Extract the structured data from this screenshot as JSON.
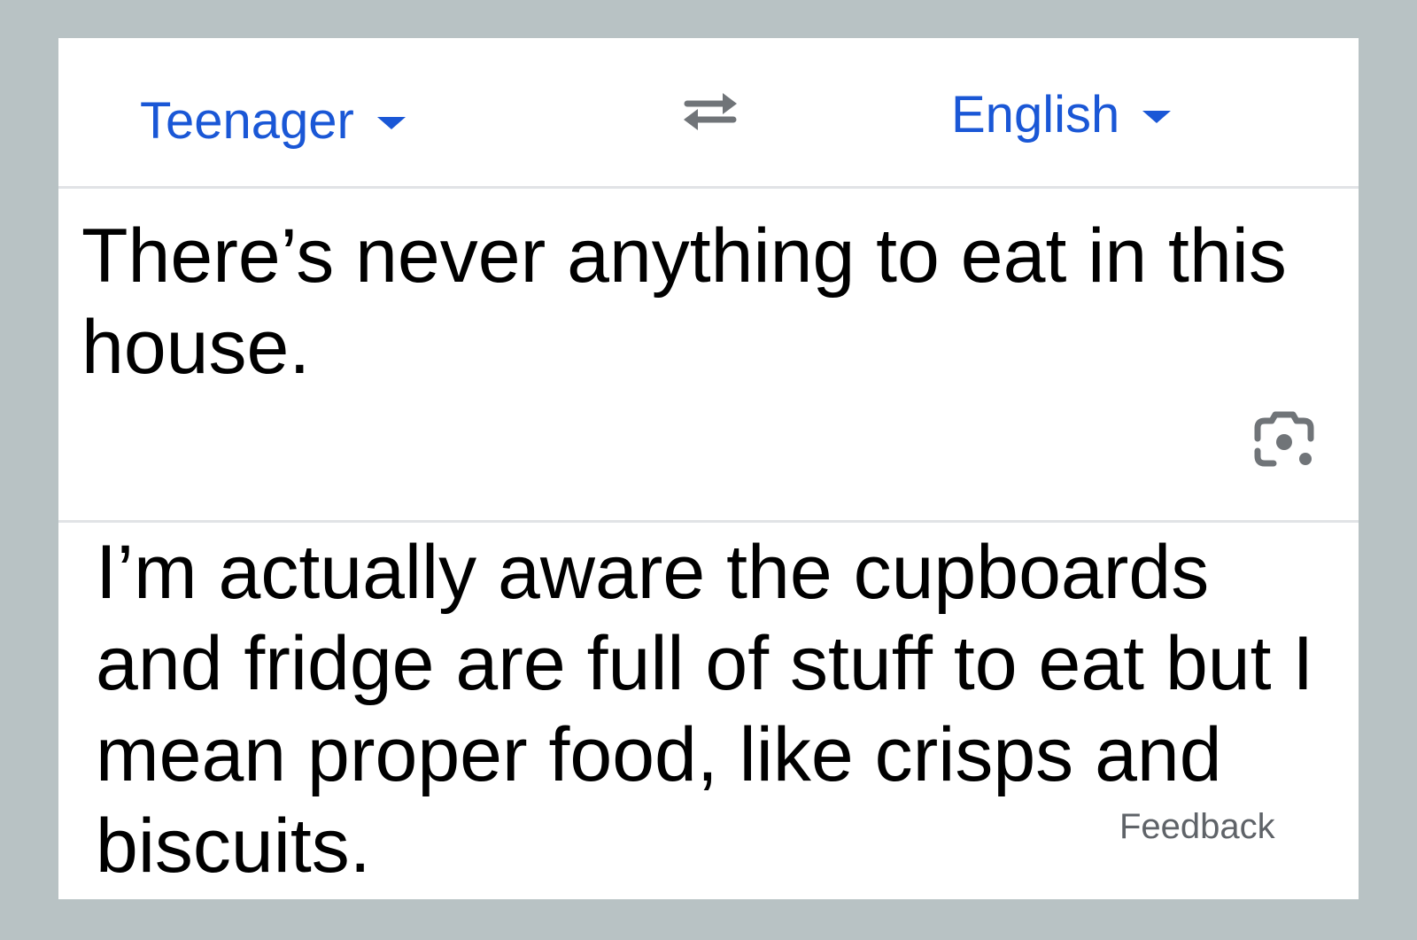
{
  "languages": {
    "source": "Teenager",
    "target": "English"
  },
  "icons": {
    "source_dropdown": "caret-down-icon",
    "target_dropdown": "caret-down-icon",
    "swap": "swap-arrows-icon",
    "camera": "camera-lens-icon"
  },
  "source": {
    "text": "There’s never anything to eat in this house."
  },
  "translation": {
    "text": "I’m actually aware the cupboards and fridge are full of stuff to eat but I mean proper food, like crisps and biscuits."
  },
  "feedback_label": "Feedback",
  "colors": {
    "accent": "#1a57d6",
    "page_background": "#b8c2c4",
    "card_background": "#ffffff",
    "icon_gray": "#707478",
    "muted_text": "#5f6368"
  }
}
